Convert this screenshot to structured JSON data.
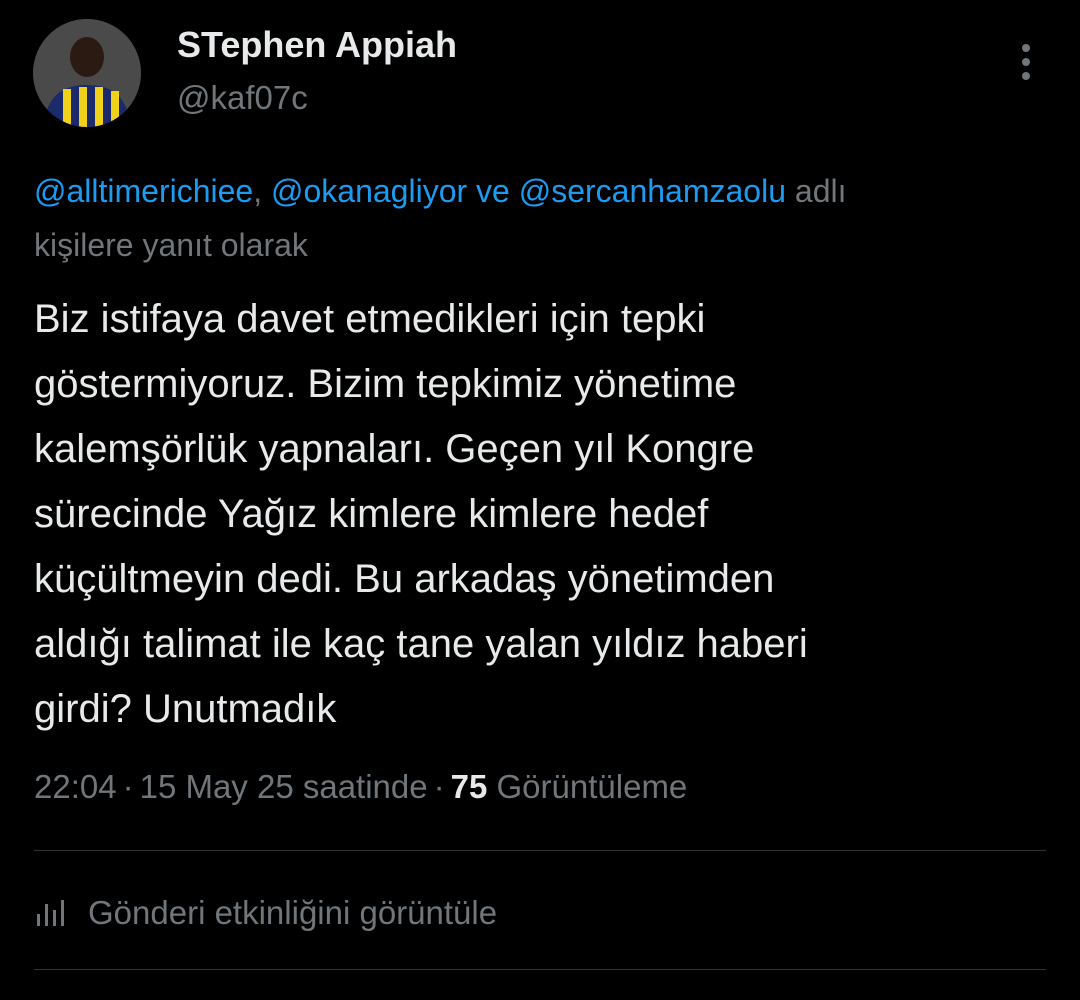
{
  "author": {
    "display_name": "STephen Appiah",
    "handle": "@kaf07c",
    "avatar_icon": "user-avatar"
  },
  "more_icon": "more-vertical-icon",
  "reply_context": {
    "mentions": [
      "@alltimerichiee",
      "@okanagliyor",
      "@sercanhamzaolu"
    ],
    "separator": ",",
    "conjunction": "ve",
    "suffix_line1": "adlı",
    "suffix_line2": "kişilere yanıt olarak"
  },
  "tweet": {
    "lines": [
      "Biz istifaya davet etmedikleri için tepki",
      "göstermiyoruz. Bizim tepkimiz yönetime",
      "kalemşörlük yapnaları. Geçen yıl Kongre",
      "sürecinde Yağız kimlere kimlere hedef",
      "küçültmeyin dedi. Bu arkadaş yönetimden",
      "aldığı talimat ile kaç tane yalan yıldız haberi",
      "girdi? Unutmadık"
    ]
  },
  "meta": {
    "time": "22:04",
    "dot": "·",
    "date": "15 May 25 saatinde",
    "views_count": "75",
    "views_label": "Görüntüleme"
  },
  "activity": {
    "icon": "analytics-bars-icon",
    "label": "Gönderi etkinliğini görüntüle"
  },
  "colors": {
    "background": "#000000",
    "primary_text": "#e7e9ea",
    "secondary_text": "#71767b",
    "link": "#1d9bf0",
    "divider": "#2f3336"
  }
}
